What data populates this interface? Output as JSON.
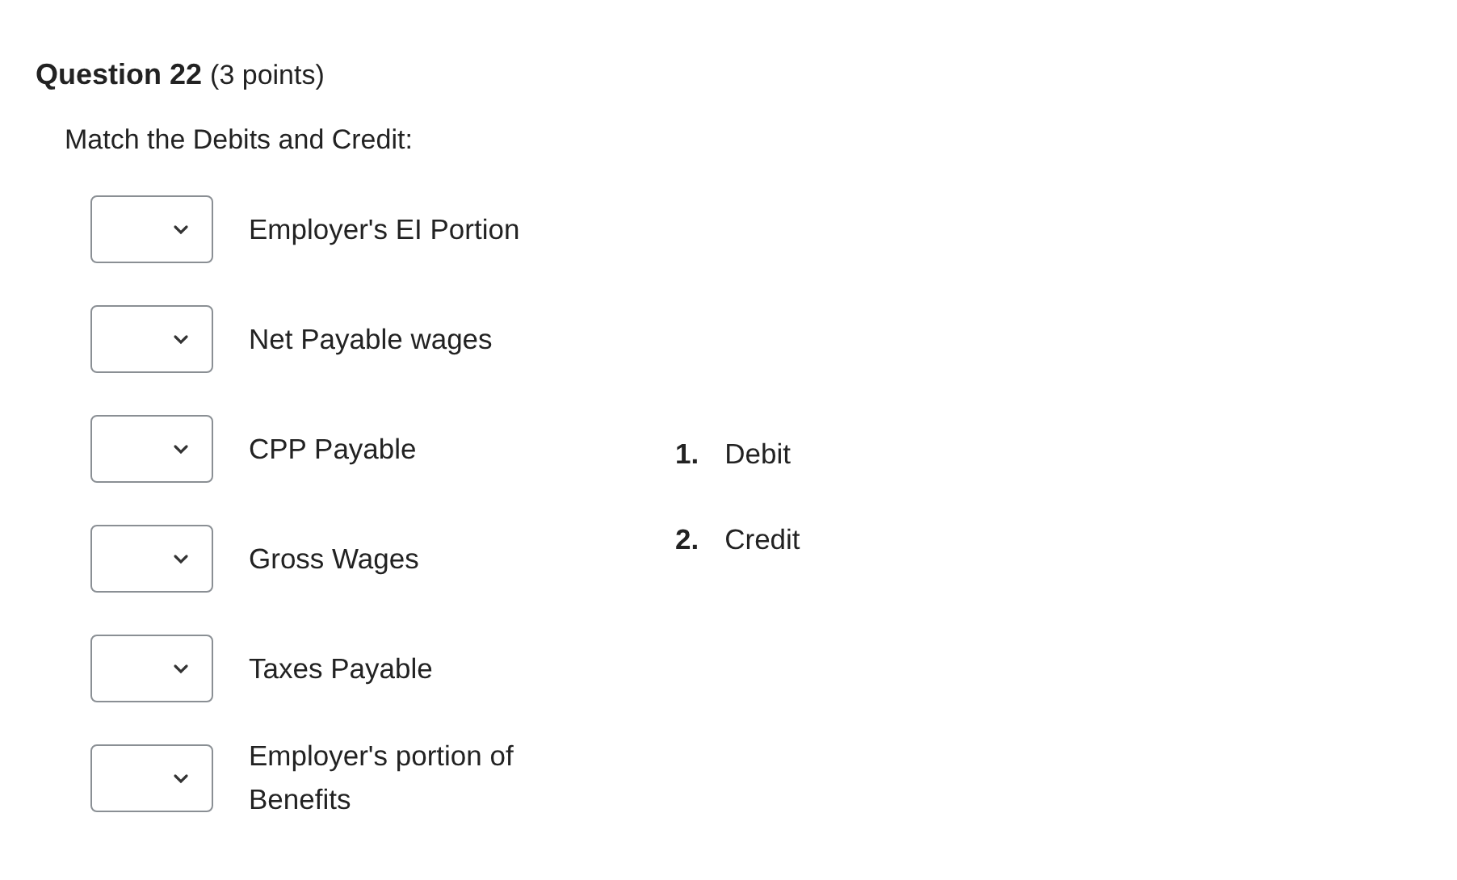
{
  "question": {
    "title": "Question 22",
    "points": "(3 points)",
    "prompt": "Match the Debits and Credit:"
  },
  "items": [
    {
      "label": "Employer's EI Portion"
    },
    {
      "label": "Net Payable wages"
    },
    {
      "label": "CPP Payable"
    },
    {
      "label": "Gross Wages"
    },
    {
      "label": "Taxes Payable"
    },
    {
      "label": "Employer's portion of Benefits"
    }
  ],
  "answers": [
    {
      "number": "1.",
      "text": "Debit"
    },
    {
      "number": "2.",
      "text": "Credit"
    }
  ]
}
